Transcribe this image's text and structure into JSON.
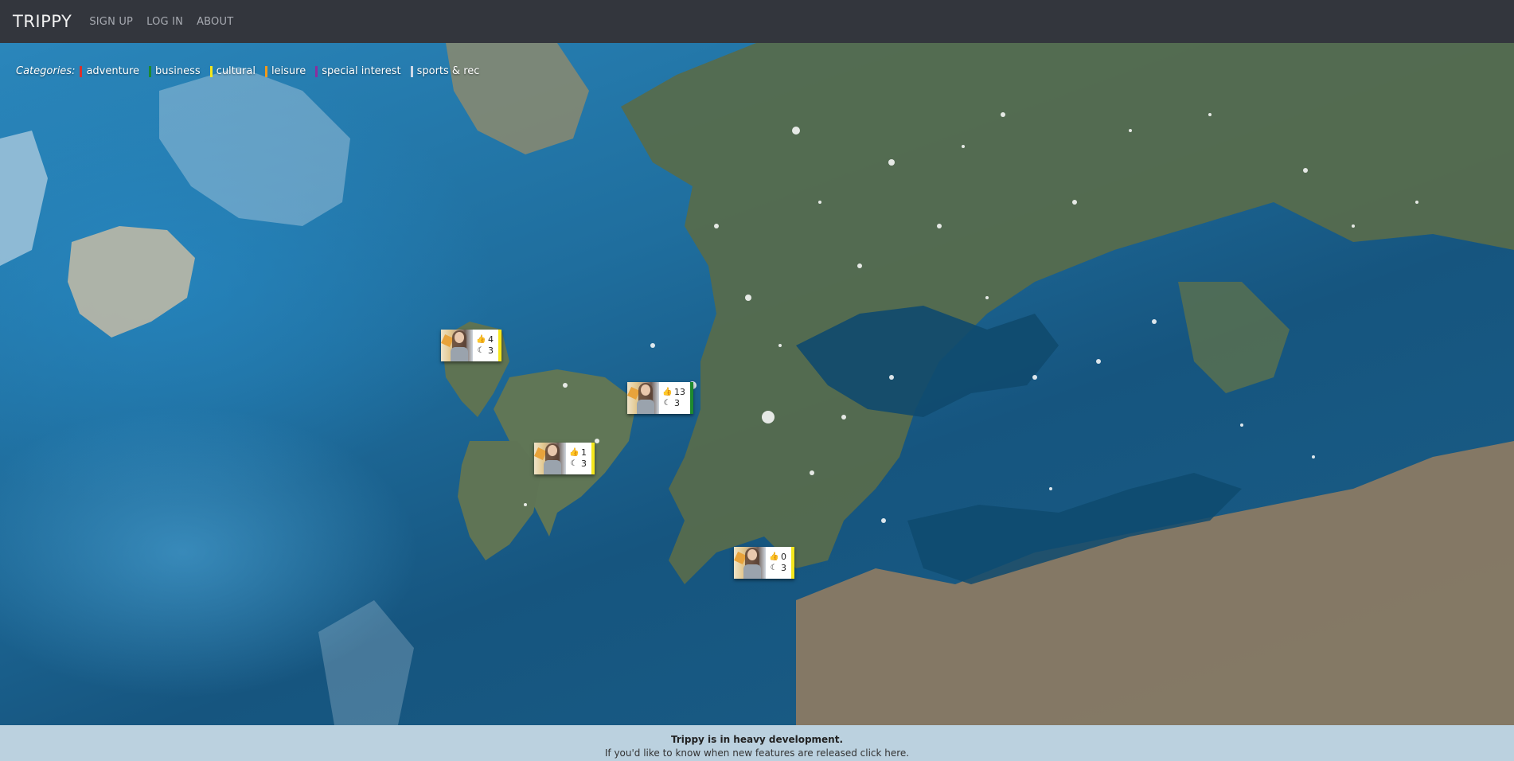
{
  "nav": {
    "brand": "TRIPPY",
    "links": [
      "SIGN UP",
      "LOG IN",
      "ABOUT"
    ]
  },
  "categories": {
    "label": "Categories:",
    "items": [
      {
        "label": "adventure",
        "color": "#d9302b"
      },
      {
        "label": "business",
        "color": "#1e8a2e"
      },
      {
        "label": "cultural",
        "color": "#f4e61b"
      },
      {
        "label": "leisure",
        "color": "#f29a1c"
      },
      {
        "label": "special interest",
        "color": "#8a2e9e"
      },
      {
        "label": "sports & rec",
        "color": "#cfd8e6"
      }
    ]
  },
  "markers": [
    {
      "likes": "4",
      "nights": "3",
      "category_color": "#f4e61b"
    },
    {
      "likes": "13",
      "nights": "3",
      "category_color": "#1e8a2e"
    },
    {
      "likes": "1",
      "nights": "3",
      "category_color": "#f4e61b"
    },
    {
      "likes": "0",
      "nights": "3",
      "category_color": "#f4e61b"
    }
  ],
  "footer": {
    "title": "Trippy is in heavy development.",
    "subtitle": "If you'd like to know when new features are released click here."
  },
  "icons": {
    "like": "thumbs-up-icon",
    "night": "moon-icon"
  }
}
